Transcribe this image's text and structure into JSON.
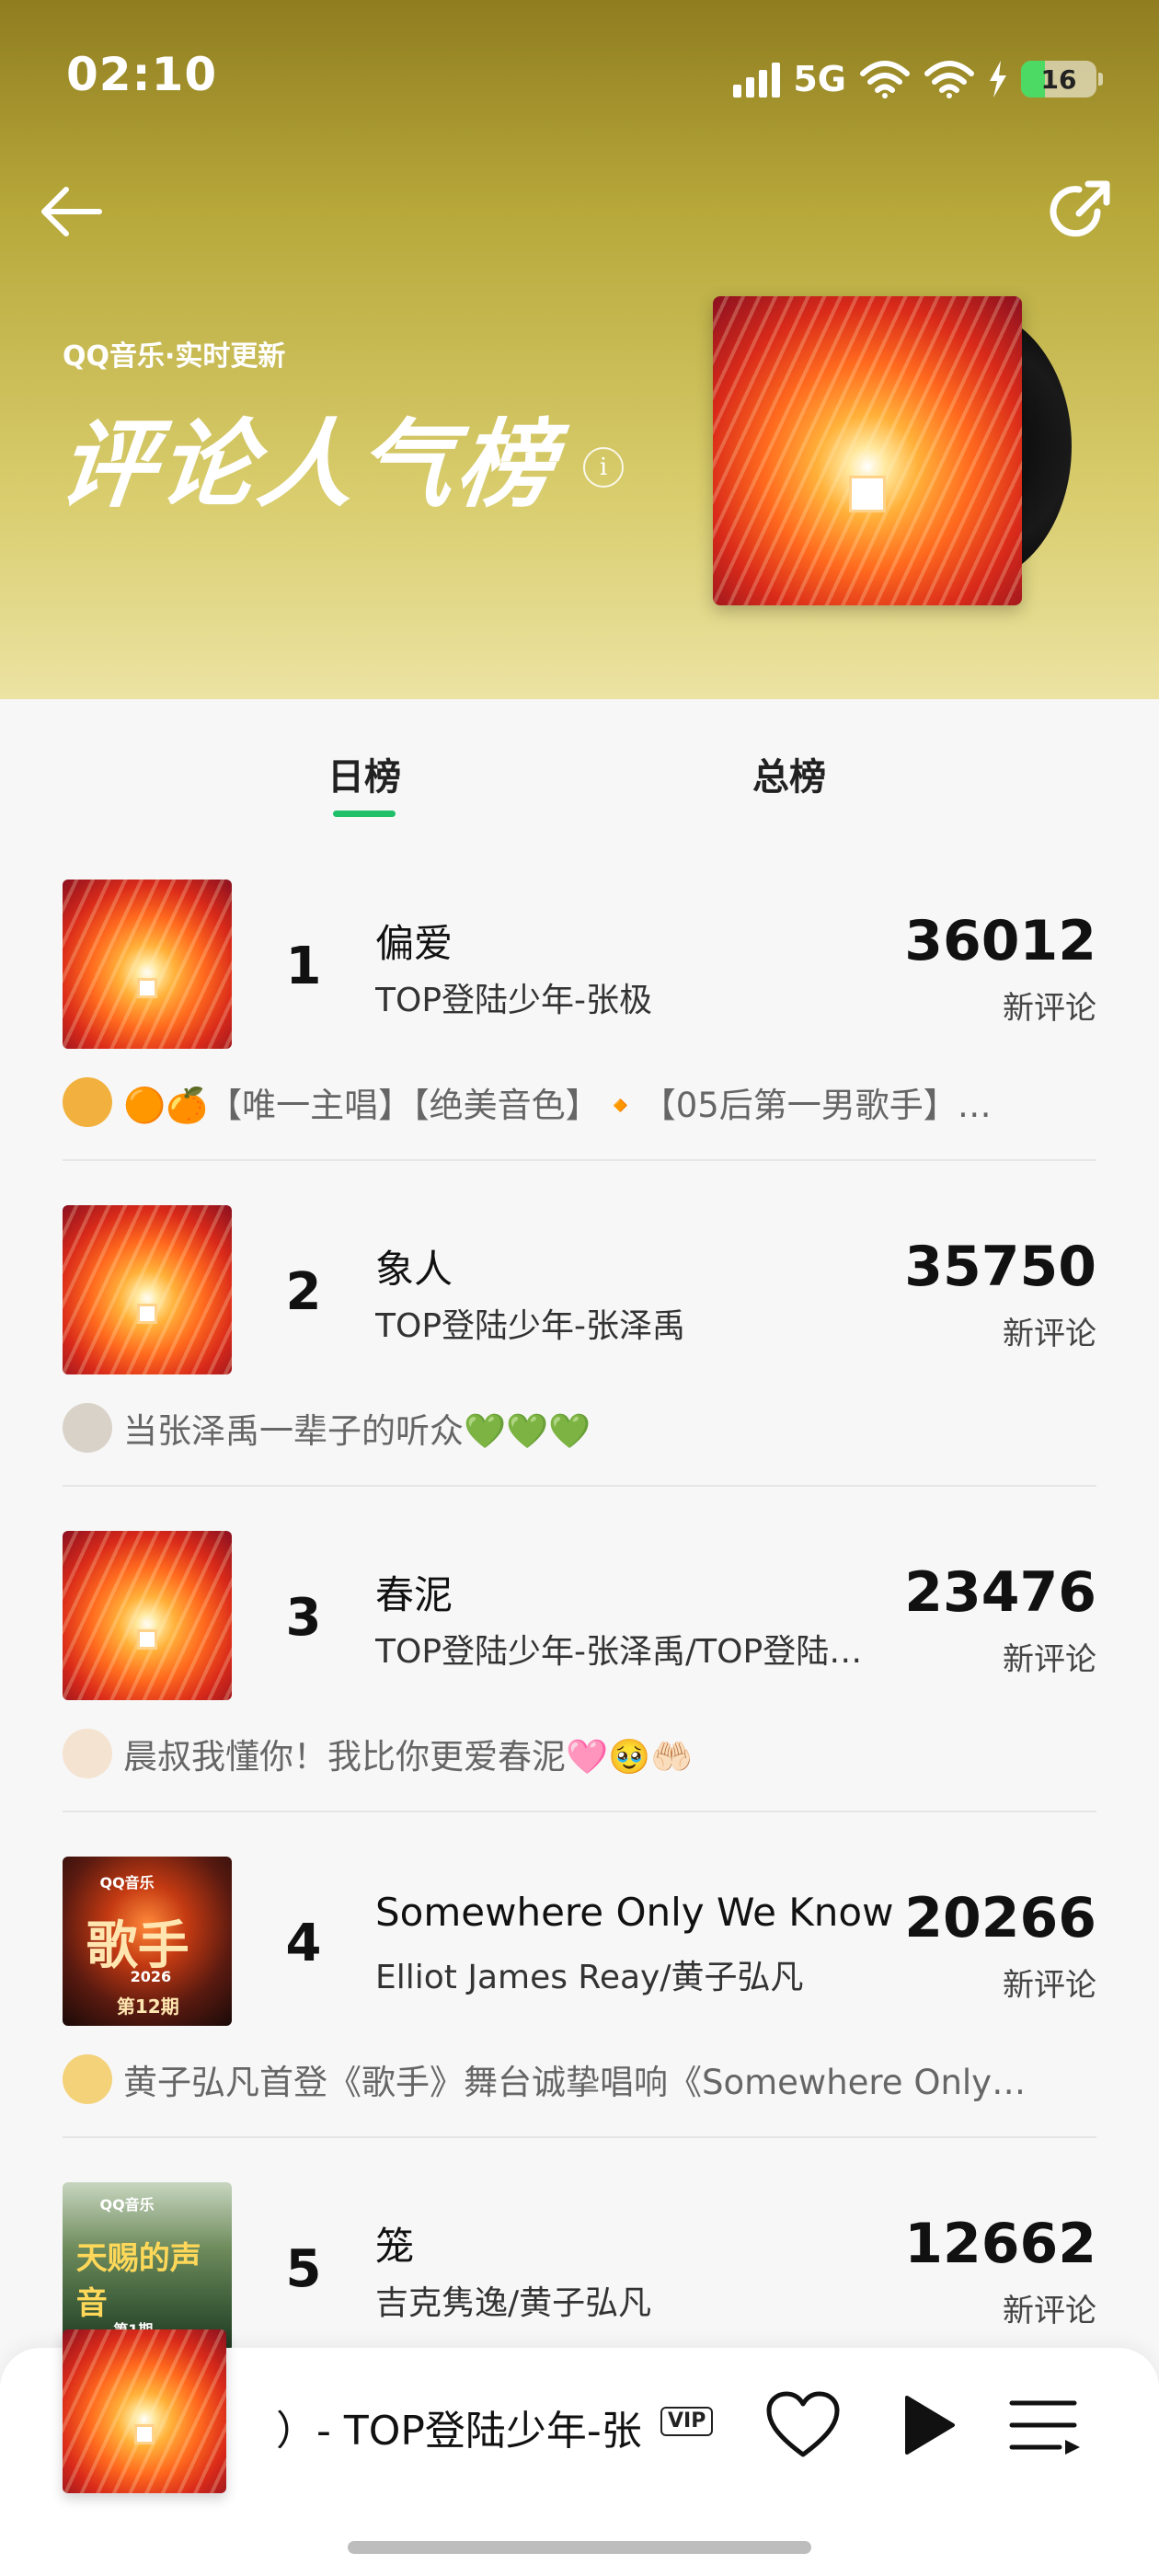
{
  "status_bar": {
    "time": "02:10",
    "network": "5G",
    "battery": "16"
  },
  "header": {
    "subtitle": "QQ音乐·实时更新",
    "title": "评论人气榜",
    "info_glyph": "i"
  },
  "tabs": [
    {
      "label": "日榜",
      "active": true
    },
    {
      "label": "总榜",
      "active": false
    }
  ],
  "list_items": [
    {
      "rank": "1",
      "song": "偏爱",
      "artist": "TOP登陆少年-张极",
      "count": "36012",
      "count_label": "新评论",
      "comment": "🟠🍊【唯一主唱】【绝美音色】🔸【05后第一男歌手】…",
      "cover": "eternal"
    },
    {
      "rank": "2",
      "song": "象人",
      "artist": "TOP登陆少年-张泽禹",
      "count": "35750",
      "count_label": "新评论",
      "comment": "当张泽禹一辈子的听众💚💚💚",
      "cover": "eternal"
    },
    {
      "rank": "3",
      "song": "春泥",
      "artist": "TOP登陆少年-张泽禹/TOP登陆…",
      "count": "23476",
      "count_label": "新评论",
      "comment": "晨叔我懂你！我比你更爱春泥🩷🥹🤲🏻",
      "cover": "eternal"
    },
    {
      "rank": "4",
      "song": "Somewhere Only We Know",
      "artist": "Elliot James Reay/黄子弘凡",
      "count": "20266",
      "count_label": "新评论",
      "comment": "黄子弘凡首登《歌手》舞台诚挚唱响《Somewhere Only…",
      "cover": "singer",
      "cover_text": {
        "logo": "QQ音乐",
        "main": "歌手",
        "year": "2026",
        "sub": "第12期"
      }
    },
    {
      "rank": "5",
      "song": "笼",
      "artist": "吉克隽逸/黄子弘凡",
      "count": "12662",
      "count_label": "新评论",
      "comment": "",
      "cover": "voice",
      "cover_text": {
        "logo": "QQ音乐",
        "main": "天赐的声音",
        "sub": "第1期"
      }
    }
  ],
  "player": {
    "track": "）- TOP登陆少年-张",
    "vip_badge": "VIP"
  },
  "colors": {
    "accent": "#20c06a",
    "header_top": "#8f7d20",
    "header_bottom": "#ece3a3"
  },
  "icons": {
    "back": "arrow-left-icon",
    "share": "share-icon",
    "info": "info-icon",
    "like": "heart-icon",
    "play": "play-icon",
    "queue": "playlist-icon"
  }
}
